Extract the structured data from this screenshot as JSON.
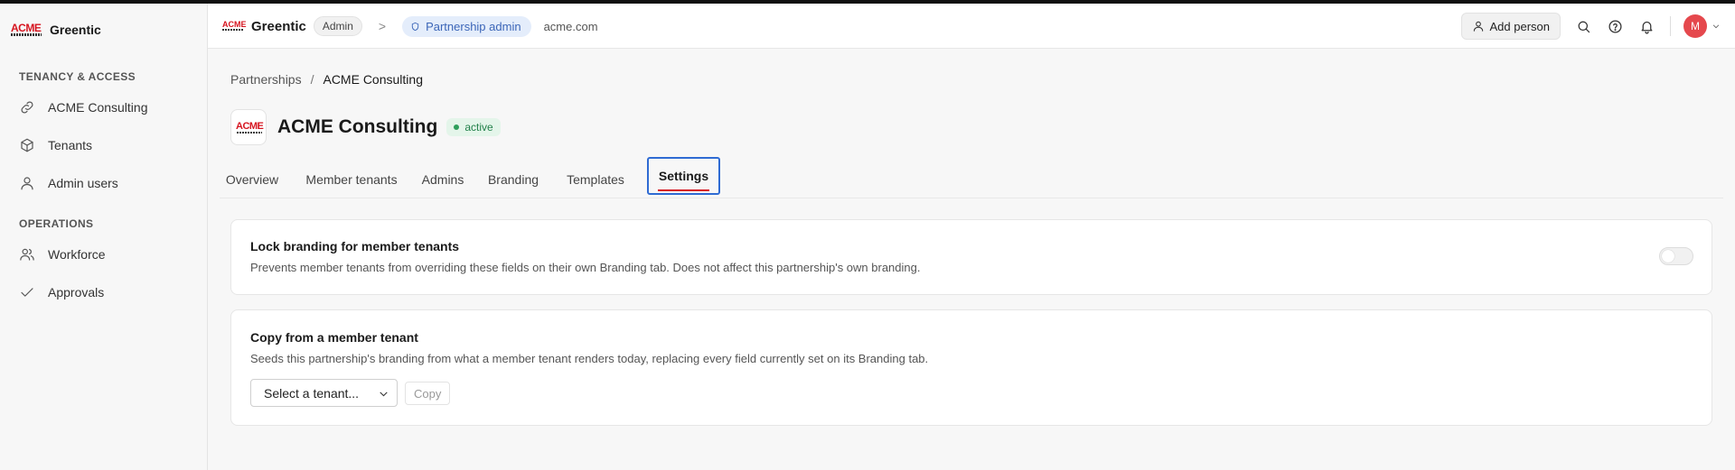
{
  "sidebar": {
    "brand_name": "Greentic",
    "logo_text": "ACME",
    "sections": [
      {
        "title": "TENANCY & ACCESS",
        "items": [
          {
            "label": "ACME Consulting",
            "icon": "link-icon"
          },
          {
            "label": "Tenants",
            "icon": "cube-icon"
          },
          {
            "label": "Admin users",
            "icon": "user-icon"
          }
        ]
      },
      {
        "title": "OPERATIONS",
        "items": [
          {
            "label": "Workforce",
            "icon": "users-icon"
          },
          {
            "label": "Approvals",
            "icon": "check-icon"
          }
        ]
      }
    ]
  },
  "header": {
    "logo_text": "ACME",
    "app_name": "Greentic",
    "role_pill": "Admin",
    "crumb_separator": ">",
    "context_pill": "Partnership admin",
    "domain": "acme.com",
    "add_person_label": "Add person",
    "avatar_initial": "M"
  },
  "breadcrumb": {
    "parent": "Partnerships",
    "separator": "/",
    "current": "ACME Consulting"
  },
  "page": {
    "logo_text": "ACME",
    "title": "ACME Consulting",
    "status": "active"
  },
  "tabs": [
    {
      "label": "Overview",
      "active": false
    },
    {
      "label": "Member tenants",
      "active": false
    },
    {
      "label": "Admins",
      "active": false
    },
    {
      "label": "Branding",
      "active": false
    },
    {
      "label": "Templates",
      "active": false
    },
    {
      "label": "Settings",
      "active": true
    }
  ],
  "lock_card": {
    "title": "Lock branding for member tenants",
    "description": "Prevents member tenants from overriding these fields on their own Branding tab. Does not affect this partnership's own branding.",
    "toggle_on": false
  },
  "copy_card": {
    "title": "Copy from a member tenant",
    "description": "Seeds this partnership's branding from what a member tenant renders today, replacing every field currently set on its Branding tab.",
    "select_value": "Select a tenant...",
    "copy_label": "Copy"
  },
  "colors": {
    "accent": "#2f6bd3",
    "brand_red": "#d6141f",
    "avatar": "#e5484d",
    "status_green": "#22804a",
    "partner_blue": "#3c66b8"
  }
}
